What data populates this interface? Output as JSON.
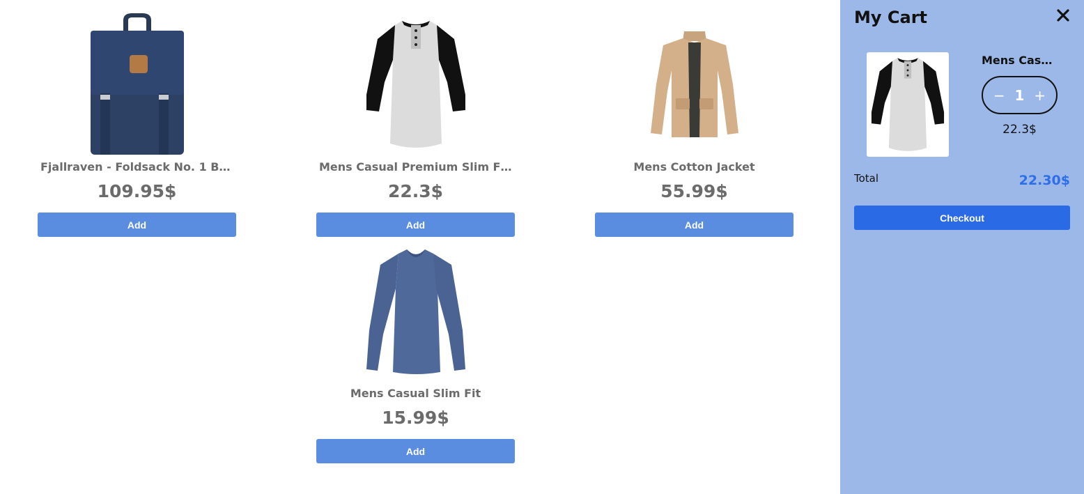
{
  "products": [
    {
      "title": "Fjallraven - Foldsack No. 1 Back...",
      "price": "109.95$",
      "add_label": "Add",
      "image": "backpack-image"
    },
    {
      "title": "Mens Casual Premium Slim Fit ...",
      "price": "22.3$",
      "add_label": "Add",
      "image": "raglan-tshirt-image"
    },
    {
      "title": "Mens Cotton Jacket",
      "price": "55.99$",
      "add_label": "Add",
      "image": "jacket-image"
    },
    {
      "title": "Mens Casual Slim Fit",
      "price": "15.99$",
      "add_label": "Add",
      "image": "long-sleeve-shirt-image"
    }
  ],
  "cart": {
    "title": "My Cart",
    "close_icon": "close-icon",
    "items": [
      {
        "name": "Mens Casu...",
        "quantity": "1",
        "minus": "−",
        "plus": "+",
        "price": "22.3$",
        "image": "raglan-tshirt-image"
      }
    ],
    "total_label": "Total",
    "total_value": "22.30$",
    "checkout_label": "Checkout"
  },
  "colors": {
    "cart_background": "#9cb8e8",
    "add_button": "#5a8ddf",
    "checkout_button": "#2a6ae4",
    "total_value": "#2e6ee6",
    "product_text": "#6b6b6b"
  }
}
